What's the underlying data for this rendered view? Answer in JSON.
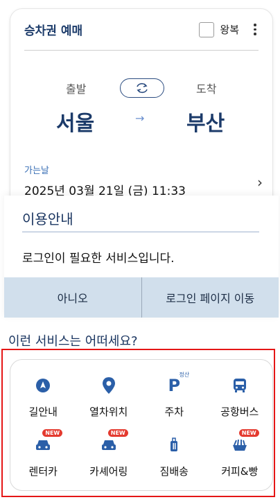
{
  "ticket": {
    "title": "승차권 예매",
    "roundtrip_label": "왕복",
    "departure_label": "출발",
    "arrival_label": "도착",
    "departure_city": "서울",
    "arrival_city": "부산",
    "arrow": "→",
    "date_label": "가는날",
    "date_value": "2025년 03월 21일 (금) 11:33",
    "chevron": "›"
  },
  "dialog": {
    "title": "이용안내",
    "message": "로그인이 필요한 서비스입니다.",
    "no_label": "아니오",
    "login_label": "로그인 페이지 이동"
  },
  "services": {
    "title": "이런 서비스는 어떠세요?",
    "badge_text": "NEW",
    "parking_sub": "정산",
    "items": [
      {
        "label": "길안내",
        "icon": "navigation-icon"
      },
      {
        "label": "열차위치",
        "icon": "location-pin-icon"
      },
      {
        "label": "주차",
        "icon": "parking-icon"
      },
      {
        "label": "공항버스",
        "icon": "bus-icon"
      },
      {
        "label": "렌터카",
        "icon": "car-icon"
      },
      {
        "label": "카셰어링",
        "icon": "car-icon"
      },
      {
        "label": "짐배송",
        "icon": "luggage-icon"
      },
      {
        "label": "커피&빵",
        "icon": "coffee-icon"
      }
    ]
  },
  "colors": {
    "brand": "#1c3b6a",
    "accent": "#2b5fa8",
    "button_bar": "#d1dfec",
    "highlight": "#e51616",
    "badge": "#e43a2f"
  }
}
